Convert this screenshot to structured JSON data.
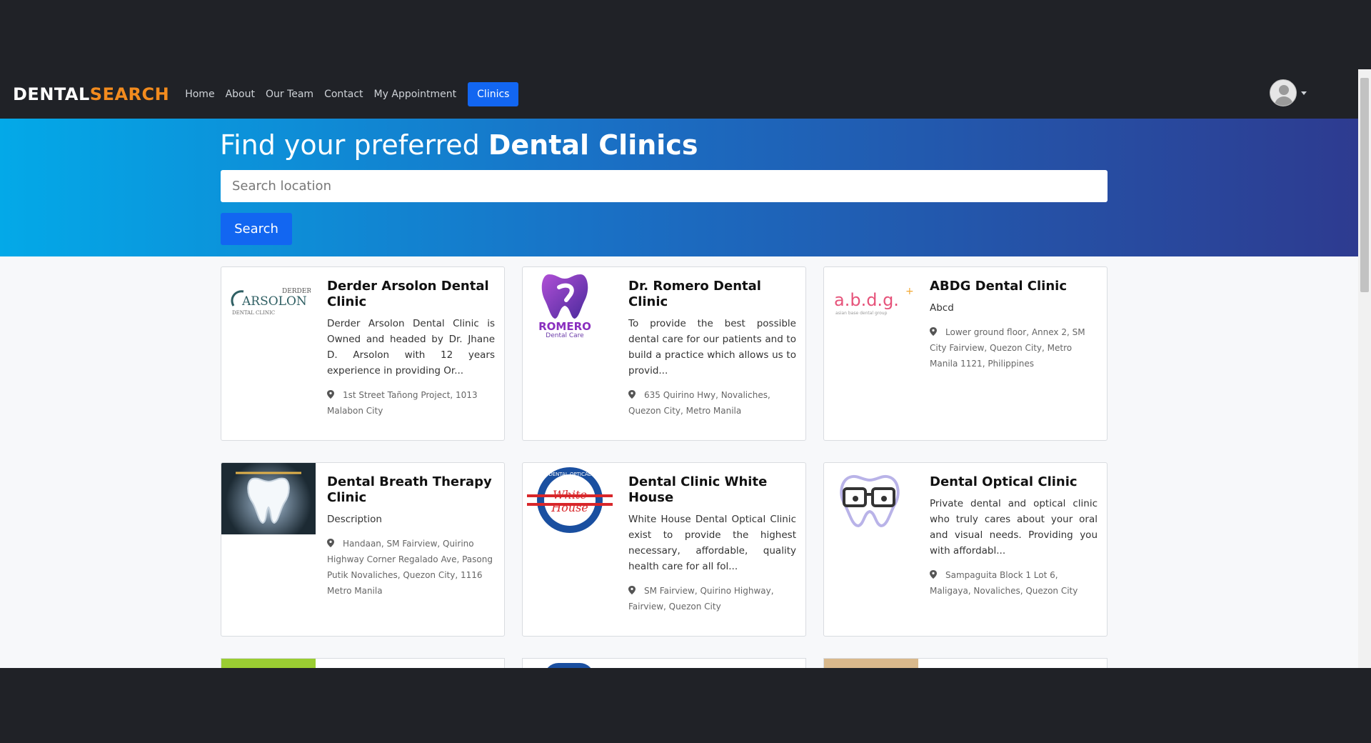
{
  "navbar": {
    "brand_part1": "DENTAL",
    "brand_part2": "SEARCH",
    "links": [
      "Home",
      "About",
      "Our Team",
      "Contact",
      "My Appointment"
    ],
    "active_link": "Clinics",
    "user_icon": "user-avatar-icon",
    "dropdown_icon": "caret-down-icon"
  },
  "hero": {
    "title_prefix": "Find your preferred",
    "title_bold": "Dental Clinics",
    "search_placeholder": "Search location",
    "search_button": "Search"
  },
  "clinics": [
    {
      "name": "Derder Arsolon Dental Clinic",
      "description": "Derder Arsolon Dental Clinic is Owned and headed by Dr. Jhane D. Arsolon with 12 years experience in providing Or...",
      "address": "1st Street Tañong Project, 1013 Malabon City",
      "logo_lines": [
        "DERDER",
        "ARSOLON",
        "DENTAL CLINIC"
      ]
    },
    {
      "name": "Dr. Romero Dental Clinic",
      "description": "To provide the best possible dental care for our patients and to build a practice which allows us to provid...",
      "address": "635 Quirino Hwy, Novaliches, Quezon City, Metro Manila",
      "logo_lines": [
        "ROMERO",
        "Dental Care"
      ]
    },
    {
      "name": "ABDG Dental Clinic",
      "description": "Abcd",
      "address": "Lower ground floor, Annex 2, SM City Fairview, Quezon City, Metro Manila 1121, Philippines",
      "logo_lines": [
        "a.b.d.g.",
        "+",
        "asian base dental group"
      ]
    },
    {
      "name": "Dental Breath Therapy Clinic",
      "description": "Description",
      "address": "Handaan, SM Fairview, Quirino Highway Corner Regalado Ave, Pasong Putik Novaliches, Quezon City, 1116 Metro Manila",
      "logo_lines": []
    },
    {
      "name": "Dental Clinic White House",
      "description": "White House Dental Optical Clinic exist to provide the highest necessary, affordable, quality health care for all fol...",
      "address": "SM Fairview, Quirino Highway, Fairview, Quezon City",
      "logo_lines": [
        "White",
        "House",
        "DENTAL OPTICAL"
      ]
    },
    {
      "name": "Dental Optical Clinic",
      "description": "Private dental and optical clinic who truly cares about your oral and visual needs. Providing you with affordabl...",
      "address": "Sampaguita Block 1 Lot 6, Maligaya, Novaliches, Quezon City",
      "logo_lines": []
    }
  ],
  "icons": {
    "address": "map-marker-icon"
  }
}
